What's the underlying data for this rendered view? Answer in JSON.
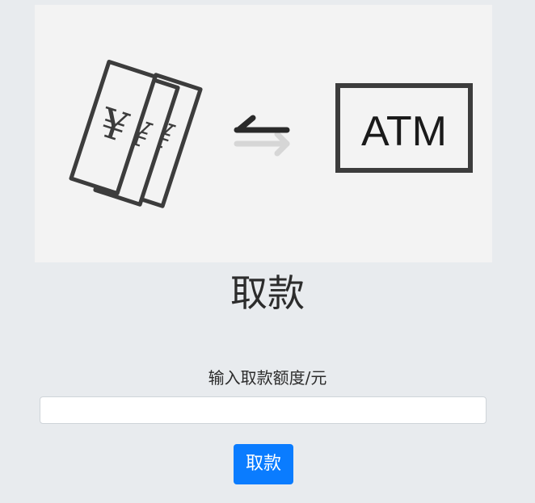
{
  "banner": {
    "currency_symbol": "¥",
    "atm_label": "ATM",
    "icons": [
      "banknotes-icon",
      "exchange-arrows-icon",
      "atm-icon"
    ]
  },
  "title": "取款",
  "form": {
    "amount_label": "输入取款额度/元",
    "amount_value": "",
    "amount_placeholder": ""
  },
  "actions": {
    "withdraw_label": "取款"
  },
  "colors": {
    "background": "#e8ebee",
    "banner_background": "#f3f3f3",
    "icon_stroke": "#3c3c3c",
    "arrow_secondary": "#d6d6d6",
    "button": "#0a7cff"
  }
}
